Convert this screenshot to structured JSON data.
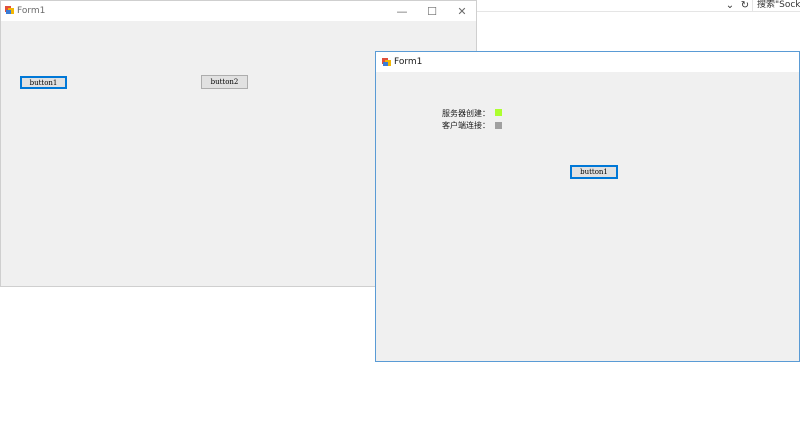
{
  "background_ide": {
    "dropdown_icon": "chevron-down-icon",
    "refresh_icon": "refresh-icon",
    "search_label": "搜索\"Sock..."
  },
  "window1": {
    "title": "Form1",
    "icon": "winform-app-icon",
    "caption_buttons": {
      "minimize": "—",
      "maximize": "☐",
      "close": "✕"
    },
    "button1_label": "button1",
    "button2_label": "button2"
  },
  "window2": {
    "title": "Form1",
    "icon": "winform-app-icon",
    "server_created_label": "服务器创建：",
    "client_connected_label": "客户端连接：",
    "server_indicator_color": "#adff2f",
    "client_indicator_color": "#a0a0a0",
    "button1_label": "button1"
  },
  "colors": {
    "focus_border": "#0078d7",
    "window_bg": "#f0f0f0",
    "active_window_border": "#5a9bd5"
  }
}
